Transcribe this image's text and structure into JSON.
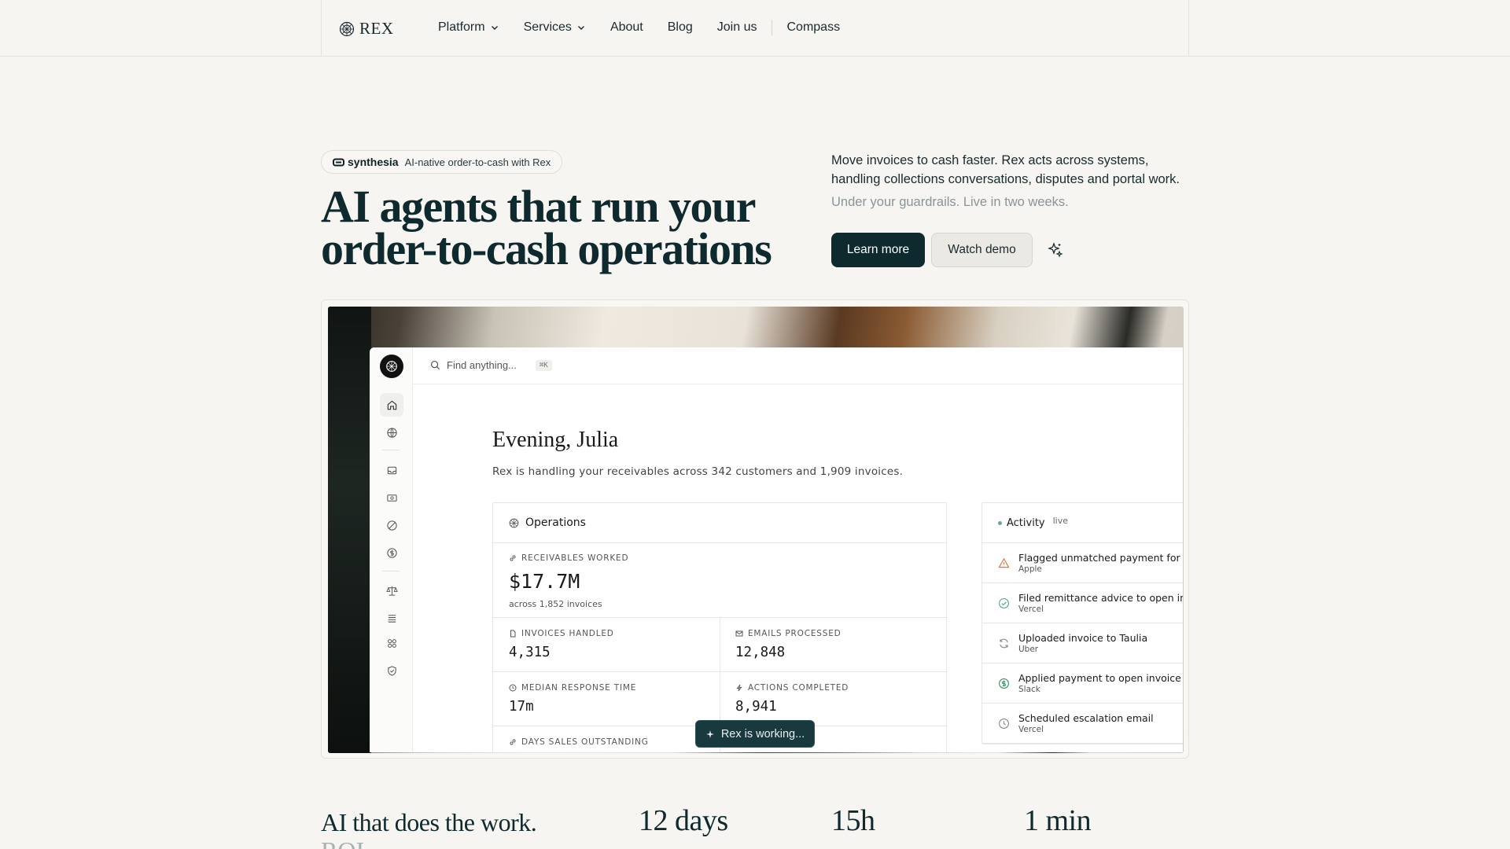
{
  "nav": {
    "brand": "REX",
    "links": [
      {
        "label": "Platform",
        "dropdown": true
      },
      {
        "label": "Services",
        "dropdown": true
      },
      {
        "label": "About",
        "dropdown": false
      },
      {
        "label": "Blog",
        "dropdown": false
      },
      {
        "label": "Join us",
        "dropdown": false
      }
    ],
    "compass": "Compass"
  },
  "hero": {
    "badge_brand": "synthesia",
    "badge_text": "AI-native order-to-cash with Rex",
    "title": "AI agents that run your order-to-cash operations",
    "description": "Move invoices to cash faster. Rex acts across systems, handling collections conversations, disputes and portal work.",
    "subtext": "Under your guardrails. Live in two weeks.",
    "primary_button": "Learn more",
    "secondary_button": "Watch demo"
  },
  "app": {
    "search_placeholder": "Find anything...",
    "search_shortcut": "⌘K",
    "greeting": "Evening, Julia",
    "summary": "Rex is handling your receivables across 342 customers and 1,909 invoices.",
    "operations": {
      "title": "Operations",
      "receivables_label": "Receivables worked",
      "receivables_value": "$17.7M",
      "receivables_sub": "across 1,852 invoices",
      "invoices_label": "Invoices handled",
      "invoices_value": "4,315",
      "emails_label": "Emails processed",
      "emails_value": "12,848",
      "response_label": "Median response time",
      "response_value": "17m",
      "actions_label": "Actions completed",
      "actions_value": "8,941",
      "dso_label": "Days sales outstanding"
    },
    "working_label": "Rex is working...",
    "activity": {
      "title": "Activity",
      "live": "live",
      "items": [
        {
          "text": "Flagged unmatched payment for re",
          "company": "Apple",
          "icon": "warning-icon",
          "color": "#e07a4a"
        },
        {
          "text": "Filed remittance advice to open inv",
          "company": "Vercel",
          "icon": "check-circle-icon",
          "color": "#5aa88a"
        },
        {
          "text": "Uploaded invoice to Taulia",
          "company": "Uber",
          "icon": "refresh-icon",
          "color": "#888888"
        },
        {
          "text": "Applied payment to open invoice",
          "company": "Slack",
          "icon": "dollar-icon",
          "color": "#3a8a6a"
        },
        {
          "text": "Scheduled escalation email",
          "company": "Vercel",
          "icon": "clock-icon",
          "color": "#888888"
        }
      ]
    }
  },
  "bottom": {
    "title": "AI that does the work.",
    "roi": "ROI",
    "stats": [
      "12 days",
      "15h",
      "1 min"
    ]
  },
  "colors": {
    "accent": "#0e2a2f",
    "background": "#f6f5f1"
  }
}
